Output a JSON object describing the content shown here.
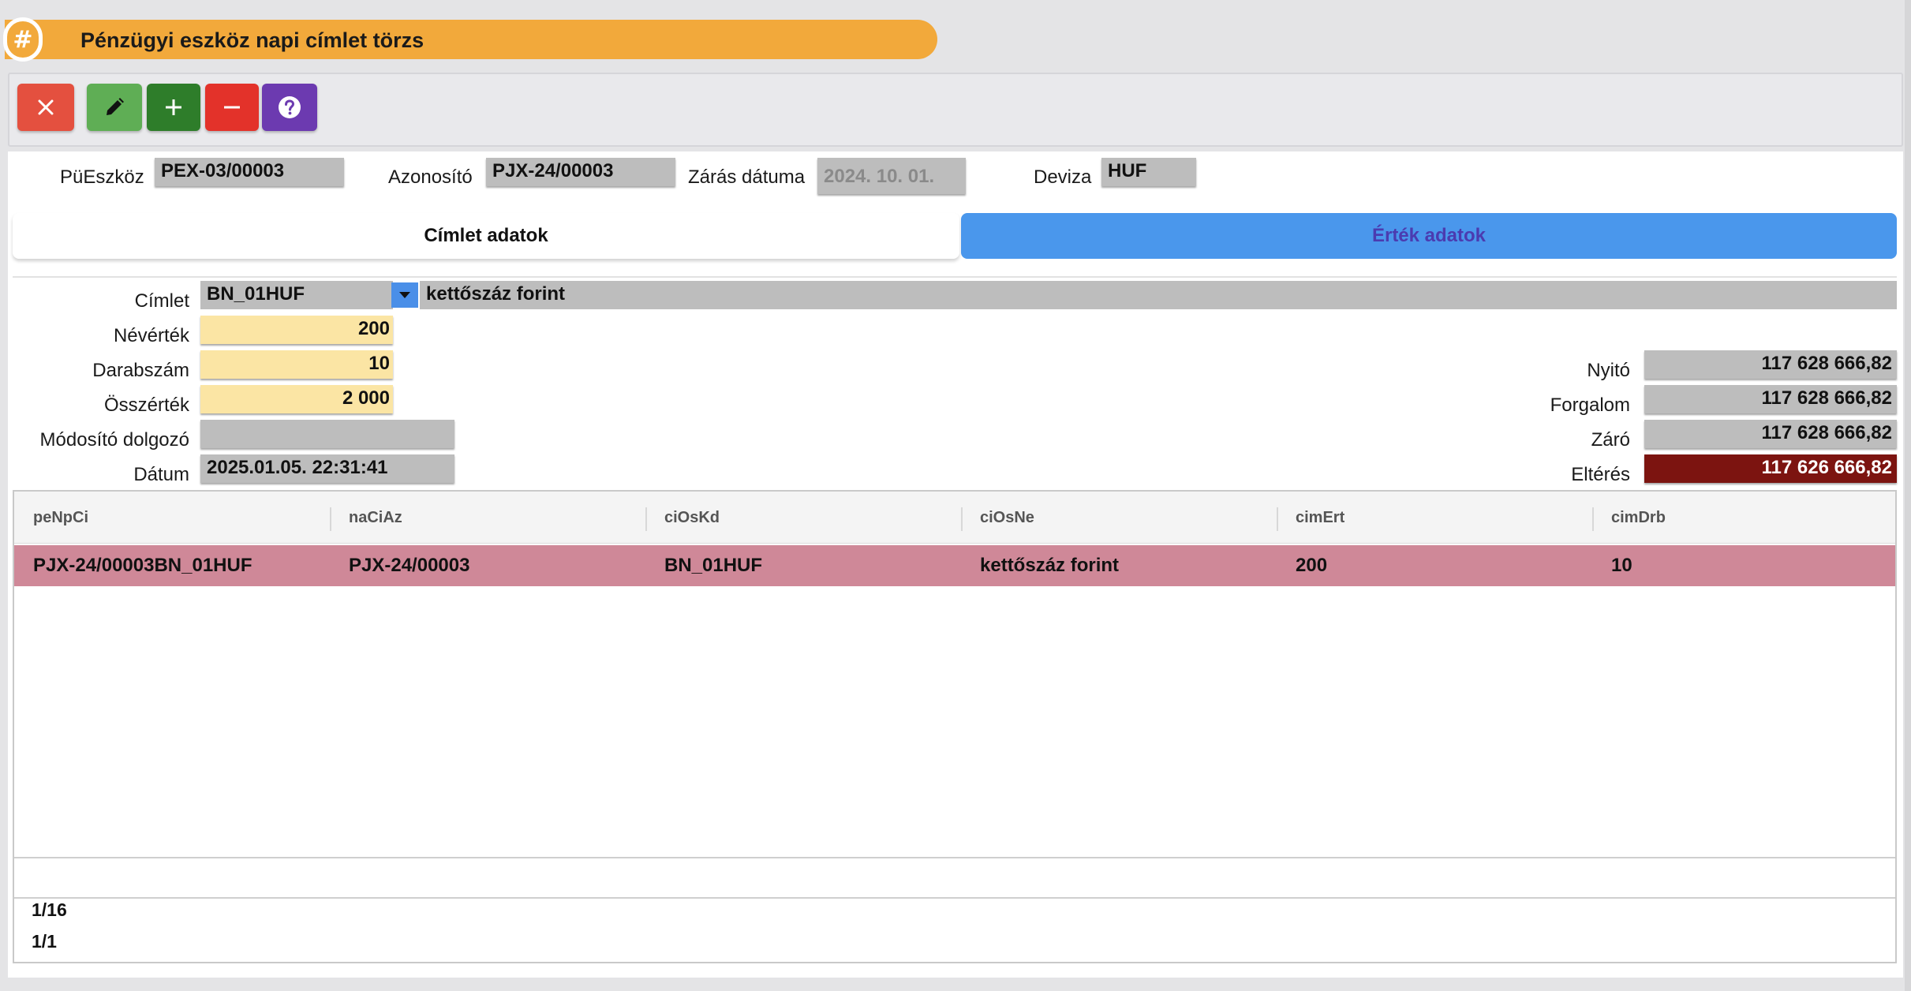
{
  "title": "Pénzügyi eszköz napi címlet törzs",
  "title_icon": "hash-icon",
  "toolbar": {
    "buttons": [
      {
        "name": "close-button",
        "icon": "close-icon",
        "color": "#e4503f"
      },
      {
        "name": "edit-button",
        "icon": "pencil-icon",
        "color": "#5fae55"
      },
      {
        "name": "add-button",
        "icon": "plus-icon",
        "color": "#2e7d2a"
      },
      {
        "name": "delete-button",
        "icon": "minus-icon",
        "color": "#e3322a"
      },
      {
        "name": "help-button",
        "icon": "question-icon",
        "color": "#6c3ab0"
      }
    ]
  },
  "header": {
    "pueszkoz_label": "PüEszköz",
    "pueszkoz_value": "PEX-03/00003",
    "azonosito_label": "Azonosító",
    "azonosito_value": "PJX-24/00003",
    "zaras_label": "Zárás dátuma",
    "zaras_value": "2024. 10. 01.",
    "deviza_label": "Deviza",
    "deviza_value": "HUF"
  },
  "tabs": {
    "cimlet": "Címlet adatok",
    "ertek": "Érték adatok",
    "active_color": "#4a97ec"
  },
  "form": {
    "cimlet_label": "Címlet",
    "cimlet_value": "BN_01HUF",
    "cimlet_name": "kettőszáz forint",
    "nevertek_label": "Névérték",
    "nevertek_value": "200",
    "darabszam_label": "Darabszám",
    "darabszam_value": "10",
    "osszertek_label": "Összérték",
    "osszertek_value": "2 000",
    "modosito_label": "Módosító dolgozó",
    "modosito_value": "",
    "datum_label": "Dátum",
    "datum_value": "2025.01.05. 22:31:41"
  },
  "totals": {
    "nyito_label": "Nyitó",
    "nyito_value": "117 628 666,82",
    "forgalom_label": "Forgalom",
    "forgalom_value": "117 628 666,82",
    "zaro_label": "Záró",
    "zaro_value": "117 628 666,82",
    "elteres_label": "Eltérés",
    "elteres_value": "117 626 666,82",
    "elteres_color": "#7c1410"
  },
  "grid": {
    "columns": [
      "peNpCi",
      "naCiAz",
      "ciOsKd",
      "ciOsNe",
      "cimErt",
      "cimDrb"
    ],
    "rows": [
      [
        "PJX-24/00003BN_01HUF",
        "PJX-24/00003",
        "BN_01HUF",
        "kettőszáz forint",
        "200",
        "10"
      ]
    ],
    "selected_row_color": "#cf8898",
    "page_total": "1/16",
    "page_current": "1/1"
  }
}
